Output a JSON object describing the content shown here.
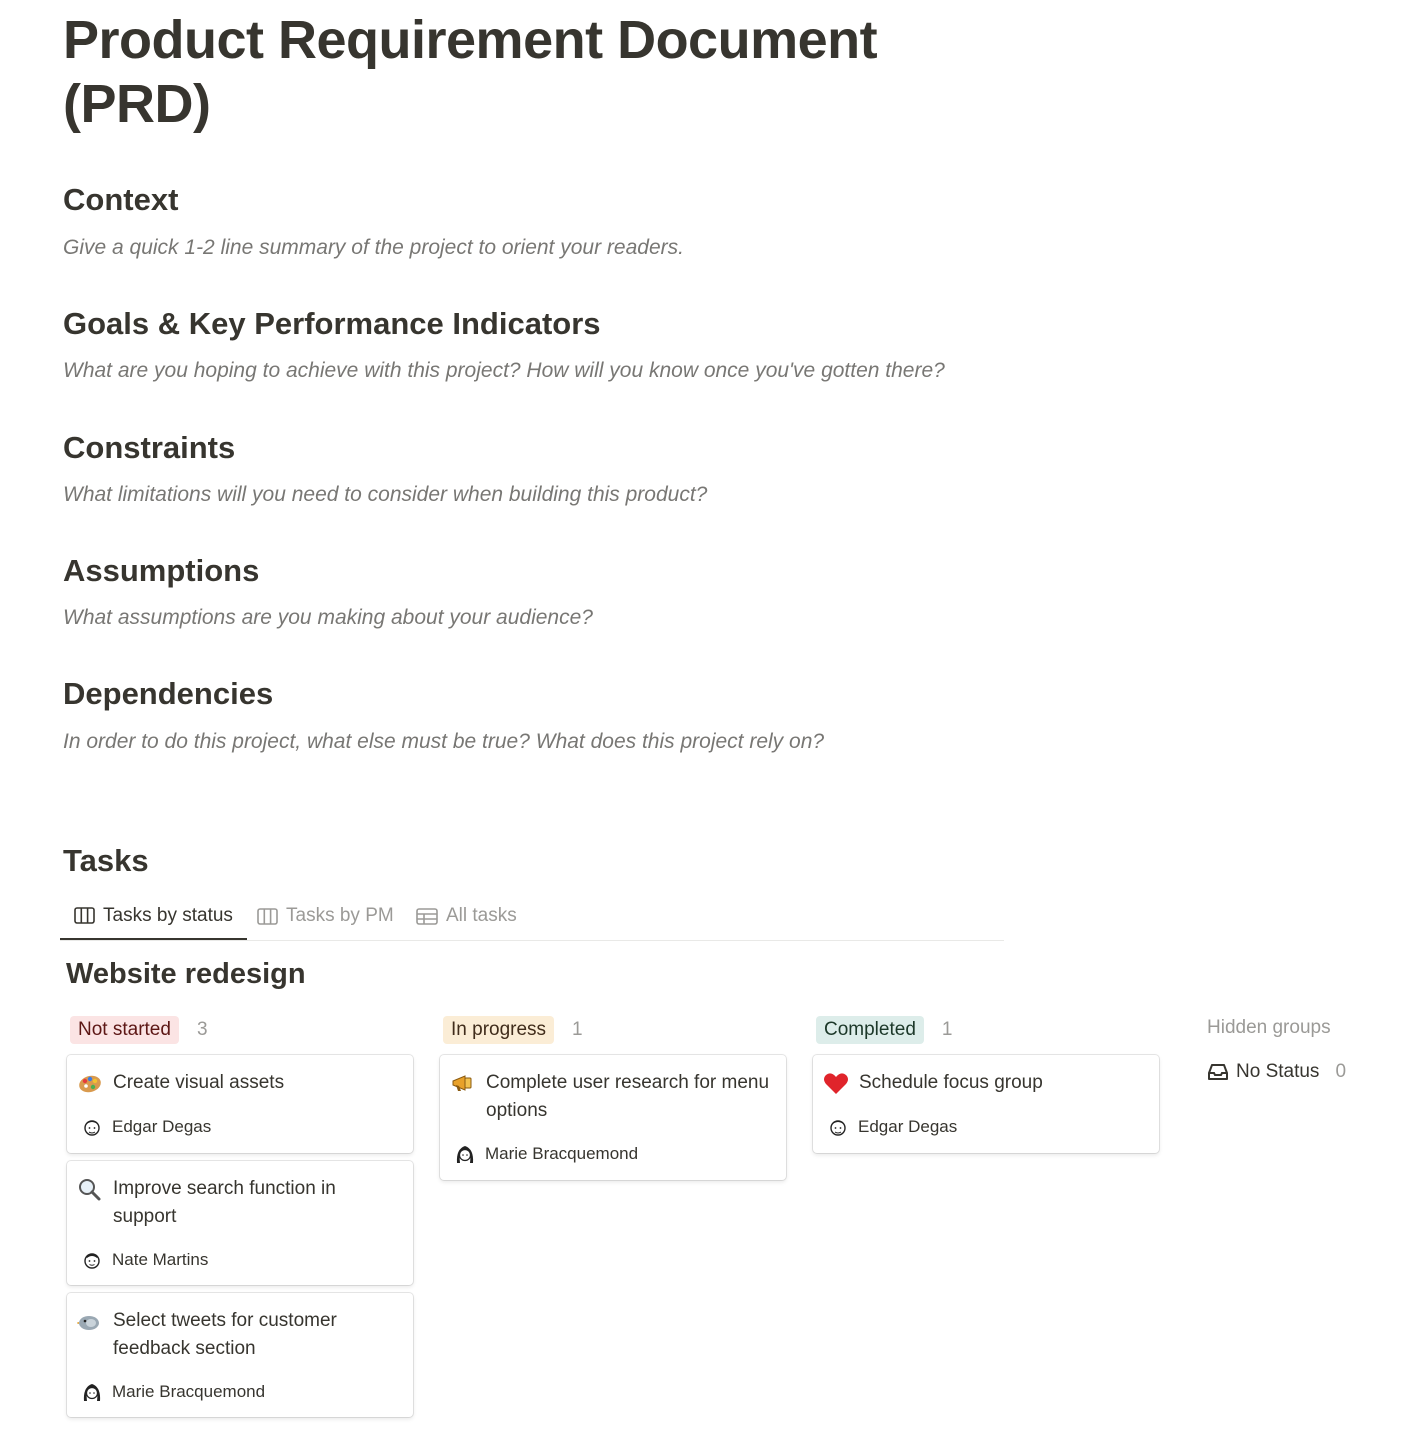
{
  "page": {
    "title": "Product Requirement Document (PRD)"
  },
  "sections": [
    {
      "heading": "Context",
      "body": "Give a quick 1-2 line summary of the project to orient your readers."
    },
    {
      "heading": "Goals & Key Performance Indicators",
      "body": "What are you hoping to achieve with this project? How will you know once you've gotten there?"
    },
    {
      "heading": "Constraints",
      "body": "What limitations will you need to consider when building this product?"
    },
    {
      "heading": "Assumptions",
      "body": "What assumptions are you making about your audience?"
    },
    {
      "heading": "Dependencies",
      "body": "In order to do this project, what else must be true? What does this project rely on?"
    }
  ],
  "tasks": {
    "heading": "Tasks",
    "tabs": [
      {
        "label": "Tasks by status",
        "icon": "board-icon",
        "active": true
      },
      {
        "label": "Tasks by PM",
        "icon": "board-icon",
        "active": false
      },
      {
        "label": "All tasks",
        "icon": "table-icon",
        "active": false
      }
    ],
    "board_title": "Website redesign",
    "columns": [
      {
        "label": "Not started",
        "count": "3",
        "pill_bg": "#fbe4e4",
        "pill_color": "#5d1715",
        "cards": [
          {
            "title": "Create visual assets",
            "icon": "palette-icon",
            "assignee": "Edgar Degas"
          },
          {
            "title": "Improve search function in support",
            "icon": "magnifier-icon",
            "assignee": "Nate Martins"
          },
          {
            "title": "Select tweets for customer feedback section",
            "icon": "bird-icon",
            "assignee": "Marie Bracquemond"
          }
        ]
      },
      {
        "label": "In progress",
        "count": "1",
        "pill_bg": "#fbedd6",
        "pill_color": "#402c1b",
        "cards": [
          {
            "title": "Complete user research for menu options",
            "icon": "megaphone-icon",
            "assignee": "Marie Bracquemond"
          }
        ]
      },
      {
        "label": "Completed",
        "count": "1",
        "pill_bg": "#ddedea",
        "pill_color": "#1c3829",
        "cards": [
          {
            "title": "Schedule focus group",
            "icon": "heart-icon",
            "assignee": "Edgar Degas"
          }
        ]
      }
    ],
    "hidden_groups": {
      "label": "Hidden groups",
      "items": [
        {
          "label": "No Status",
          "count": "0",
          "icon": "inbox-icon"
        }
      ]
    }
  }
}
